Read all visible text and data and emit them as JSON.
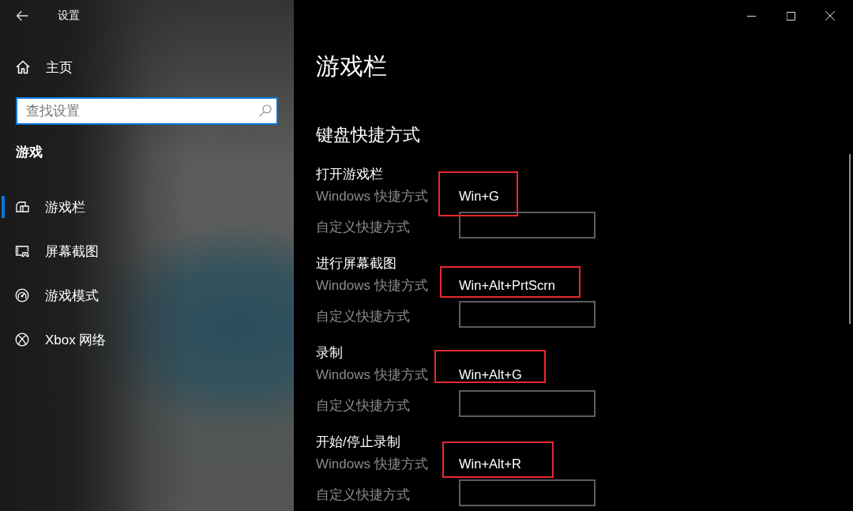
{
  "window": {
    "title": "设置"
  },
  "sidebar": {
    "home": "主页",
    "search": {
      "placeholder": "查找设置"
    },
    "category": "游戏",
    "items": [
      {
        "label": "游戏栏",
        "selected": true
      },
      {
        "label": "屏幕截图",
        "selected": false
      },
      {
        "label": "游戏模式",
        "selected": false
      },
      {
        "label": "Xbox 网络",
        "selected": false
      }
    ]
  },
  "page": {
    "title": "游戏栏",
    "section": "键盘快捷方式",
    "shortcuts": [
      {
        "action": "打开游戏栏",
        "windows_label": "Windows 快捷方式",
        "windows_value": "Win+G",
        "custom_label": "自定义快捷方式",
        "highlighted": true
      },
      {
        "action": "进行屏幕截图",
        "windows_label": "Windows 快捷方式",
        "windows_value": "Win+Alt+PrtScrn",
        "custom_label": "自定义快捷方式",
        "highlighted": true
      },
      {
        "action": "录制",
        "windows_label": "Windows 快捷方式",
        "windows_value": "Win+Alt+G",
        "custom_label": "自定义快捷方式",
        "highlighted": true
      },
      {
        "action": "开始/停止录制",
        "windows_label": "Windows 快捷方式",
        "windows_value": "Win+Alt+R",
        "custom_label": "自定义快捷方式",
        "highlighted": true
      }
    ]
  }
}
